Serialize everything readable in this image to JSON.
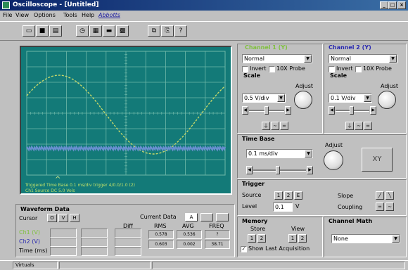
{
  "window": {
    "title": "Oscilloscope - [Untitled]",
    "minimize": "_",
    "maximize": "□",
    "close": "×"
  },
  "menu": {
    "file": "File",
    "view": "View",
    "options": "Options",
    "tools": "Tools",
    "help": "Help",
    "extra": "Abbotts"
  },
  "screen": {
    "status_line1": "Triggered      Time Base 0.1 ms/div trigger 4/0.0/1.0 (2)",
    "status_line2": "Ch1 Source DC 5.0 Vols",
    "colors": {
      "background": "#137a78",
      "grid": "#6fb8a8",
      "trace1": "#c6d86a",
      "trace2": "#6a8fd0"
    },
    "trigger_marker": "^"
  },
  "channel1": {
    "title": "Channel 1 (Y)",
    "mode": "Normal",
    "invert": "Invert",
    "probe": "10X Probe",
    "scale": "Scale",
    "scale_value": "0.5 V/div",
    "adjust": "Adjust"
  },
  "channel2": {
    "title": "Channel 2 (Y)",
    "mode": "Normal",
    "invert": "Invert",
    "probe": "10X Probe",
    "scale": "Scale",
    "scale_value": "0.1 V/div",
    "adjust": "Adjust"
  },
  "timebase": {
    "title": "Time Base",
    "value": "0.1 ms/div",
    "adjust": "Adjust",
    "xy": "XY"
  },
  "trigger": {
    "title": "Trigger",
    "source_label": "Source",
    "src1": "1",
    "src2": "2",
    "srcE": "E",
    "level_label": "Level",
    "level_value": "0.1",
    "level_unit": "V",
    "slope_label": "Slope",
    "coupling_label": "Coupling"
  },
  "memory": {
    "title": "Memory",
    "store": "Store",
    "view": "View",
    "b1": "1",
    "b2": "2",
    "show_last": "Show Last Acquisition"
  },
  "channel_math": {
    "title": "Channel Math",
    "value": "None"
  },
  "waveform": {
    "title": "Waveform Data",
    "cursor_label": "Cursor",
    "cursor_o": "O",
    "cursor_v": "V",
    "cursor_h": "H",
    "current_data": "Current Data",
    "current_a": "A",
    "rows": [
      "Ch1 (V)",
      "Ch2 (V)",
      "Time (ms)"
    ],
    "diff": "Diff",
    "col_heads": [
      "RMS",
      "AVG",
      "FREQ"
    ],
    "ch1_vals": [
      "0.578",
      "0.536",
      "?"
    ],
    "ch2_vals": [
      "0.603",
      "0.002",
      "38.71"
    ]
  },
  "status": {
    "text": "Virtuals"
  }
}
